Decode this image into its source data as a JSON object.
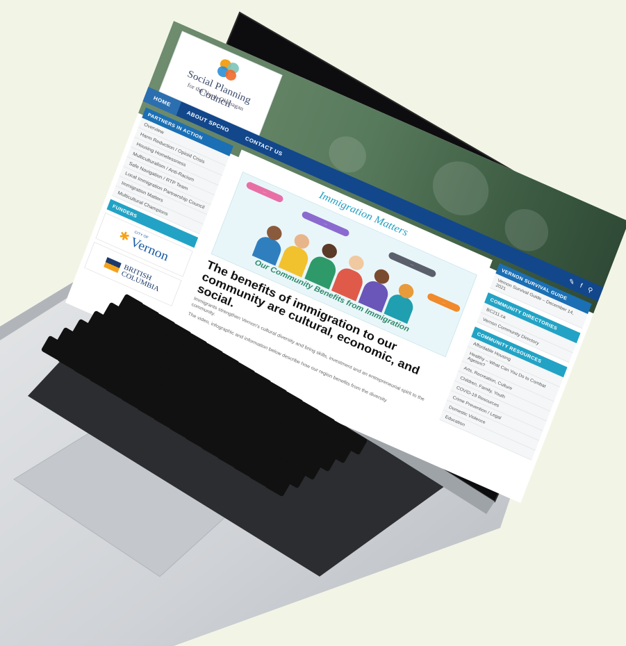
{
  "colors": {
    "background": "#f2f5e6",
    "nav_blue": "#12478c",
    "accent_teal": "#22a3c5",
    "sidebar_blue": "#1b6fb4"
  },
  "site": {
    "logo_title": "Social Planning Council",
    "logo_subtitle": "for the North Okanagan",
    "nav": [
      "HOME",
      "ABOUT SPCNO",
      "CONTACT US"
    ],
    "nav_icons": [
      "twitter-icon",
      "facebook-icon",
      "search-icon"
    ]
  },
  "left_sidebar": {
    "heading": "PARTNERS IN ACTION",
    "items": [
      "Overview",
      "Harm Reduction / Opioid Crisis",
      "Housing Homelessness",
      "Multiculturalism / Anti-Racism",
      "Safe Navigation / RTP Team",
      "Local Immigration Partnership Council",
      "Immigration Matters",
      "Multicultural Champions"
    ],
    "funders_heading": "FUNDERS",
    "funder_city_small": "CITY OF",
    "funder_city": "Vernon",
    "funder_province_1": "BRITISH",
    "funder_province_2": "COLUMBIA"
  },
  "main": {
    "title": "Immigration Matters",
    "banner_caption": "Our Community Benefits from Immigration",
    "headline": "The benefits of immigration to our community are cultural, economic, and social.",
    "para1": "Immigrants strengthen Vernon's cultural diversity and bring skills, investment and an entrepreneurial spirit to the community.",
    "para2": "The video, infographic and information below describe how our region benefits from the diversity"
  },
  "right_sidebar": {
    "guide_heading": "VERNON SURVIVAL GUIDE",
    "guide_items": [
      "Vernon Survival Guide – December 14, 2021"
    ],
    "directories_heading": "COMMUNITY DIRECTORIES",
    "directories_items": [
      "BC211.ca",
      "Vernon Community Directory"
    ],
    "resources_heading": "COMMUNITY RESOURCES",
    "resources_items": [
      "Affordable Housing",
      "Healthy – What Can You Do to Combat Ageism?",
      "Arts, Recreation, Culture",
      "Children, Family, Youth",
      "COVID-19 Resources",
      "Crime Prevention / Legal",
      "Domestic Violence",
      "Education"
    ]
  }
}
